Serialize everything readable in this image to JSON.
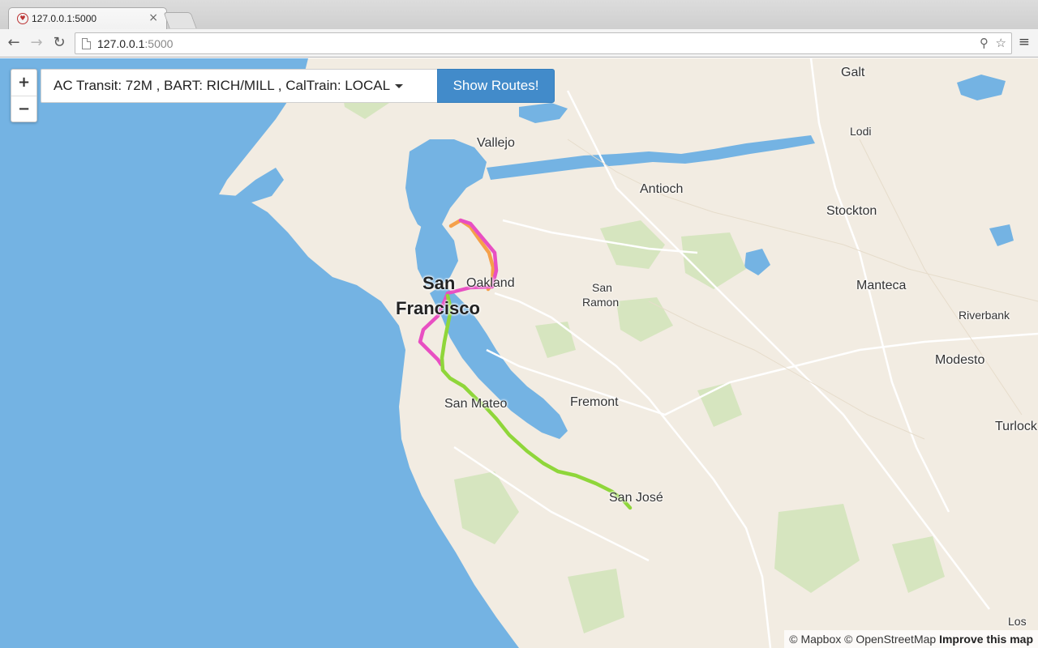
{
  "browser": {
    "tab_title": "127.0.0.1:5000",
    "url_host": "127.0.0.1",
    "url_port": ":5000"
  },
  "controls": {
    "zoom_in": "+",
    "zoom_out": "−",
    "route_selection": "AC Transit: 72M , BART: RICH/MILL , CalTrain: LOCAL",
    "show_routes_label": "Show Routes!"
  },
  "map": {
    "place_labels": {
      "galt": "Galt",
      "lodi": "Lodi",
      "vallejo": "Vallejo",
      "antioch": "Antioch",
      "stockton": "Stockton",
      "manteca": "Manteca",
      "riverbank": "Riverbank",
      "modesto": "Modesto",
      "oakland": "Oakland",
      "san_francisco_1": "San",
      "san_francisco_2": "Francisco",
      "san_ramon_1": "San",
      "san_ramon_2": "Ramon",
      "san_mateo": "San Mateo",
      "fremont": "Fremont",
      "san_jose": "San José",
      "turlock": "Turlock",
      "los": "Los"
    },
    "attribution": {
      "mapbox": "© Mapbox",
      "osm": "© OpenStreetMap",
      "improve": "Improve this map"
    },
    "colors": {
      "water": "#74b3e3",
      "land": "#f2ece2",
      "park": "#d6e5bf",
      "route_ac_transit": "#f5a04a",
      "route_bart": "#e84fc2",
      "route_caltrain": "#8fd63a"
    }
  }
}
